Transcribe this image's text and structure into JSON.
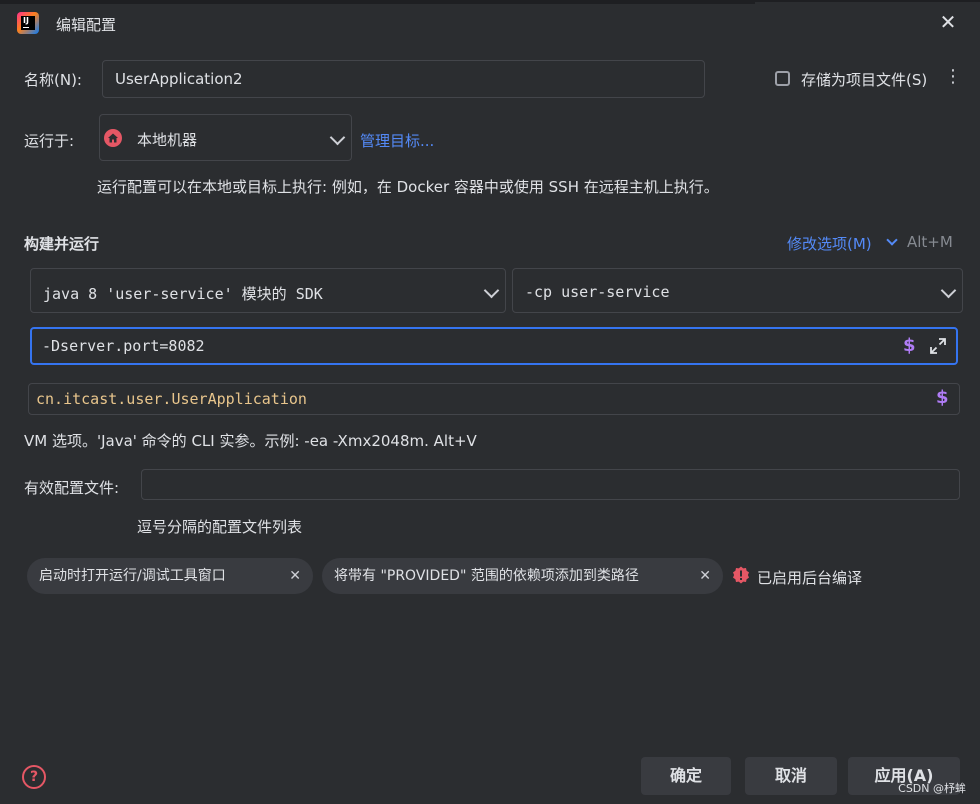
{
  "window": {
    "title": "编辑配置",
    "close_glyph": "✕"
  },
  "name_row": {
    "label": "名称(N):",
    "value": "UserApplication2",
    "store_checkbox_label": "存储为项目文件(S)",
    "store_checkbox_checked": false,
    "more_glyph": "⋮"
  },
  "run_on": {
    "label": "运行于:",
    "selected": "本地机器",
    "manage_link": "管理目标...",
    "hint": "运行配置可以在本地或目标上执行: 例如，在 Docker 容器中或使用 SSH 在远程主机上执行。"
  },
  "build_run": {
    "section_title": "构建并运行",
    "modify_options_link": "修改选项(M)",
    "modify_shortcut": "Alt+M",
    "sdk_selected": "java 8 'user-service' 模块的 SDK",
    "classpath_selected": "-cp user-service",
    "vm_options_value": "-Dserver.port=8082",
    "main_class_value": "cn.itcast.user.UserApplication",
    "vm_hint": "VM 选项。'Java' 命令的 CLI 实参。示例: -ea -Xmx2048m. Alt+V",
    "dollar_glyph": "$"
  },
  "profiles": {
    "label": "有效配置文件:",
    "value": "",
    "hint": "逗号分隔的配置文件列表"
  },
  "tags": [
    {
      "label": "启动时打开运行/调试工具窗口",
      "close_glyph": "✕"
    },
    {
      "label": "将带有 \"PROVIDED\" 范围的依赖项添加到类路径",
      "close_glyph": "✕"
    }
  ],
  "background_compile": {
    "label": "已启用后台编译",
    "icon_glyph": "!"
  },
  "footer": {
    "help_glyph": "?",
    "ok_label": "确定",
    "cancel_label": "取消",
    "apply_label": "应用(A)",
    "watermark": "CSDN @杼蛑"
  },
  "colors": {
    "background": "#2b2d30",
    "accent_link": "#548af7",
    "focus_border": "#3574f0",
    "string_orange": "#e8c58c",
    "dollar_purple": "#b07cf6",
    "error_red": "#e55765"
  }
}
